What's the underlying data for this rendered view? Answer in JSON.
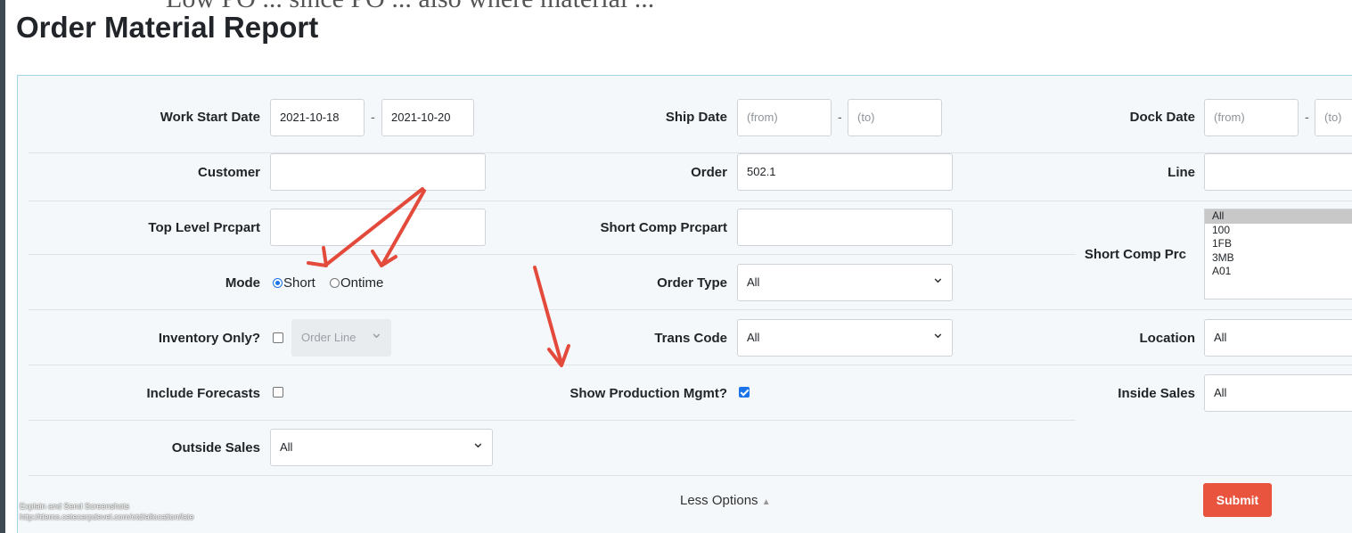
{
  "page": {
    "title": "Order Material Report",
    "bleed_text": "Low PO ... since PO ... also where material ..."
  },
  "form": {
    "work_start_date": {
      "label": "Work Start Date",
      "from": "2021-10-18",
      "to": "2021-10-20"
    },
    "ship_date": {
      "label": "Ship Date",
      "from_placeholder": "(from)",
      "to_placeholder": "(to)"
    },
    "dock_date": {
      "label": "Dock Date",
      "from_placeholder": "(from)",
      "to_placeholder": "(to)"
    },
    "customer": {
      "label": "Customer",
      "value": ""
    },
    "order": {
      "label": "Order",
      "value": "502.1"
    },
    "line": {
      "label": "Line",
      "value": ""
    },
    "top_level_prcpart": {
      "label": "Top Level Prcpart",
      "value": ""
    },
    "short_comp_prcpart": {
      "label": "Short Comp Prcpart",
      "value": ""
    },
    "short_comp_prc": {
      "label": "Short Comp Prc",
      "options": [
        "All",
        "100",
        "1FB",
        "3MB",
        "A01"
      ],
      "selected": "All"
    },
    "mode": {
      "label": "Mode",
      "options": [
        "Short",
        "Ontime"
      ],
      "selected": "Short"
    },
    "order_type": {
      "label": "Order Type",
      "value": "All"
    },
    "inventory_only": {
      "label": "Inventory Only?",
      "checked": false,
      "select_value": "Order Line"
    },
    "trans_code": {
      "label": "Trans Code",
      "value": "All"
    },
    "location": {
      "label": "Location",
      "value": "All"
    },
    "include_forecasts": {
      "label": "Include Forecasts",
      "checked": false
    },
    "show_production_mgmt": {
      "label": "Show Production Mgmt?",
      "checked": true
    },
    "inside_sales": {
      "label": "Inside Sales",
      "value": "All"
    },
    "outside_sales": {
      "label": "Outside Sales",
      "value": "All"
    }
  },
  "footer": {
    "less_options": "Less Options",
    "submit": "Submit"
  },
  "watermark": {
    "line1": "Explain and Send Screenshots",
    "line2": "http://demo.cetecerpdevel.com/otd/allocation/late"
  },
  "colors": {
    "accent": "#e8543e",
    "checkbox": "#1a73e8",
    "panel": "#f5f8fa",
    "annotation": "#e44a3c"
  }
}
